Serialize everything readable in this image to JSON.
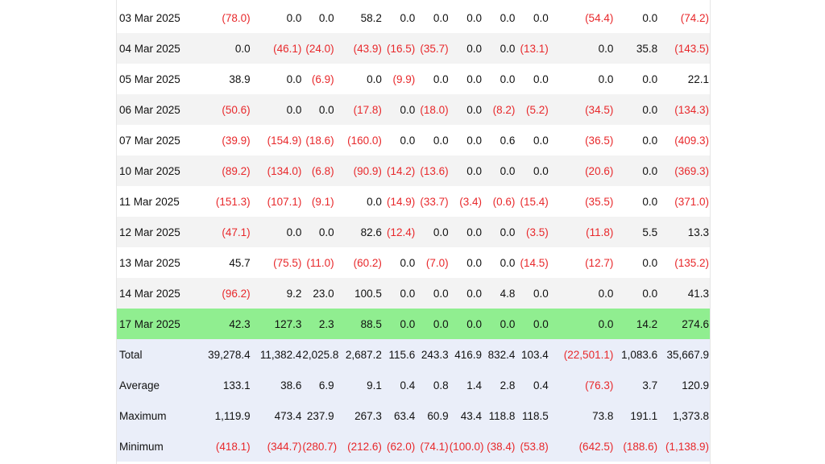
{
  "colors": {
    "negative_text": "#e8282b",
    "highlight_row": "#90ee90",
    "summary_rows": "#eaeef9",
    "alt_row": "#f3f3f3"
  },
  "rows": [
    {
      "date": "03 Mar 2025",
      "values": [
        "(78.0)",
        "0.0",
        "0.0",
        "58.2",
        "0.0",
        "0.0",
        "0.0",
        "0.0",
        "0.0",
        "(54.4)",
        "0.0",
        "(74.2)"
      ]
    },
    {
      "date": "04 Mar 2025",
      "values": [
        "0.0",
        "(46.1)",
        "(24.0)",
        "(43.9)",
        "(16.5)",
        "(35.7)",
        "0.0",
        "0.0",
        "(13.1)",
        "0.0",
        "35.8",
        "(143.5)"
      ]
    },
    {
      "date": "05 Mar 2025",
      "values": [
        "38.9",
        "0.0",
        "(6.9)",
        "0.0",
        "(9.9)",
        "0.0",
        "0.0",
        "0.0",
        "0.0",
        "0.0",
        "0.0",
        "22.1"
      ]
    },
    {
      "date": "06 Mar 2025",
      "values": [
        "(50.6)",
        "0.0",
        "0.0",
        "(17.8)",
        "0.0",
        "(18.0)",
        "0.0",
        "(8.2)",
        "(5.2)",
        "(34.5)",
        "0.0",
        "(134.3)"
      ]
    },
    {
      "date": "07 Mar 2025",
      "values": [
        "(39.9)",
        "(154.9)",
        "(18.6)",
        "(160.0)",
        "0.0",
        "0.0",
        "0.0",
        "0.6",
        "0.0",
        "(36.5)",
        "0.0",
        "(409.3)"
      ]
    },
    {
      "date": "10 Mar 2025",
      "values": [
        "(89.2)",
        "(134.0)",
        "(6.8)",
        "(90.9)",
        "(14.2)",
        "(13.6)",
        "0.0",
        "0.0",
        "0.0",
        "(20.6)",
        "0.0",
        "(369.3)"
      ]
    },
    {
      "date": "11 Mar 2025",
      "values": [
        "(151.3)",
        "(107.1)",
        "(9.1)",
        "0.0",
        "(14.9)",
        "(33.7)",
        "(3.4)",
        "(0.6)",
        "(15.4)",
        "(35.5)",
        "0.0",
        "(371.0)"
      ]
    },
    {
      "date": "12 Mar 2025",
      "values": [
        "(47.1)",
        "0.0",
        "0.0",
        "82.6",
        "(12.4)",
        "0.0",
        "0.0",
        "0.0",
        "(3.5)",
        "(11.8)",
        "5.5",
        "13.3"
      ]
    },
    {
      "date": "13 Mar 2025",
      "values": [
        "45.7",
        "(75.5)",
        "(11.0)",
        "(60.2)",
        "0.0",
        "(7.0)",
        "0.0",
        "0.0",
        "(14.5)",
        "(12.7)",
        "0.0",
        "(135.2)"
      ]
    },
    {
      "date": "14 Mar 2025",
      "values": [
        "(96.2)",
        "9.2",
        "23.0",
        "100.5",
        "0.0",
        "0.0",
        "0.0",
        "4.8",
        "0.0",
        "0.0",
        "0.0",
        "41.3"
      ]
    },
    {
      "date": "17 Mar 2025",
      "values": [
        "42.3",
        "127.3",
        "2.3",
        "88.5",
        "0.0",
        "0.0",
        "0.0",
        "0.0",
        "0.0",
        "0.0",
        "14.2",
        "274.6"
      ]
    }
  ],
  "summary": [
    {
      "label": "Total",
      "values": [
        "39,278.4",
        "11,382.4",
        "2,025.8",
        "2,687.2",
        "115.6",
        "243.3",
        "416.9",
        "832.4",
        "103.4",
        "(22,501.1)",
        "1,083.6",
        "35,667.9"
      ]
    },
    {
      "label": "Average",
      "values": [
        "133.1",
        "38.6",
        "6.9",
        "9.1",
        "0.4",
        "0.8",
        "1.4",
        "2.8",
        "0.4",
        "(76.3)",
        "3.7",
        "120.9"
      ]
    },
    {
      "label": "Maximum",
      "values": [
        "1,119.9",
        "473.4",
        "237.9",
        "267.3",
        "63.4",
        "60.9",
        "43.4",
        "118.8",
        "118.5",
        "73.8",
        "191.1",
        "1,373.8"
      ]
    },
    {
      "label": "Minimum",
      "values": [
        "(418.1)",
        "(344.7)",
        "(280.7)",
        "(212.6)",
        "(62.0)",
        "(74.1)",
        "(100.0)",
        "(38.4)",
        "(53.8)",
        "(642.5)",
        "(188.6)",
        "(1,138.9)"
      ]
    }
  ]
}
